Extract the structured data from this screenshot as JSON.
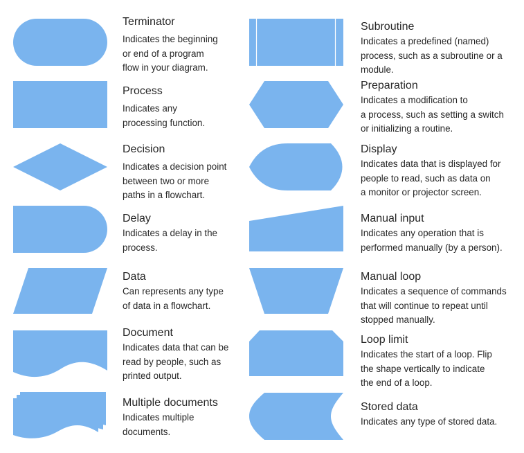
{
  "colors": {
    "shape_fill": "#7ab4ee",
    "text": "#262626",
    "background": "#ffffff"
  },
  "left": [
    {
      "id": "terminator",
      "title": "Terminator",
      "lines": [
        "Indicates the beginning",
        "or end of a program",
        "flow in your diagram."
      ]
    },
    {
      "id": "process",
      "title": "Process",
      "lines": [
        "Indicates any",
        "processing function."
      ]
    },
    {
      "id": "decision",
      "title": "Decision",
      "lines": [
        "Indicates a decision point",
        "between two or more",
        "paths in a flowchart."
      ]
    },
    {
      "id": "delay",
      "title": "Delay",
      "lines": [
        "Indicates a delay in the",
        "process."
      ]
    },
    {
      "id": "data",
      "title": "Data",
      "lines": [
        "Can represents any type",
        "of data in a flowchart."
      ]
    },
    {
      "id": "document",
      "title": "Document",
      "lines": [
        "Indicates data that can be",
        "read by people, such as",
        "printed output."
      ]
    },
    {
      "id": "multiple-documents",
      "title": "Multiple documents",
      "lines": [
        "Indicates multiple",
        "documents."
      ]
    }
  ],
  "right": [
    {
      "id": "subroutine",
      "title": "Subroutine",
      "lines": [
        "Indicates a predefined (named)",
        "process, such as a subroutine or a",
        "module."
      ]
    },
    {
      "id": "preparation",
      "title": "Preparation",
      "lines": [
        "Indicates a modification to",
        "a process, such as setting a switch",
        "or initializing a routine."
      ]
    },
    {
      "id": "display",
      "title": "Display",
      "lines": [
        "Indicates data that is displayed for",
        "people to read, such as data on",
        "a monitor or projector screen."
      ]
    },
    {
      "id": "manual-input",
      "title": "Manual input",
      "lines": [
        "Indicates any operation that is",
        "performed manually (by a person)."
      ]
    },
    {
      "id": "manual-loop",
      "title": "Manual loop",
      "lines": [
        "Indicates a sequence of commands",
        "that will continue to repeat until",
        "stopped manually."
      ]
    },
    {
      "id": "loop-limit",
      "title": "Loop limit",
      "lines": [
        "Indicates the start of a loop. Flip",
        "the shape vertically to indicate",
        "the end of a loop."
      ]
    },
    {
      "id": "stored-data",
      "title": "Stored data",
      "lines": [
        "Indicates any type of stored data."
      ]
    }
  ]
}
